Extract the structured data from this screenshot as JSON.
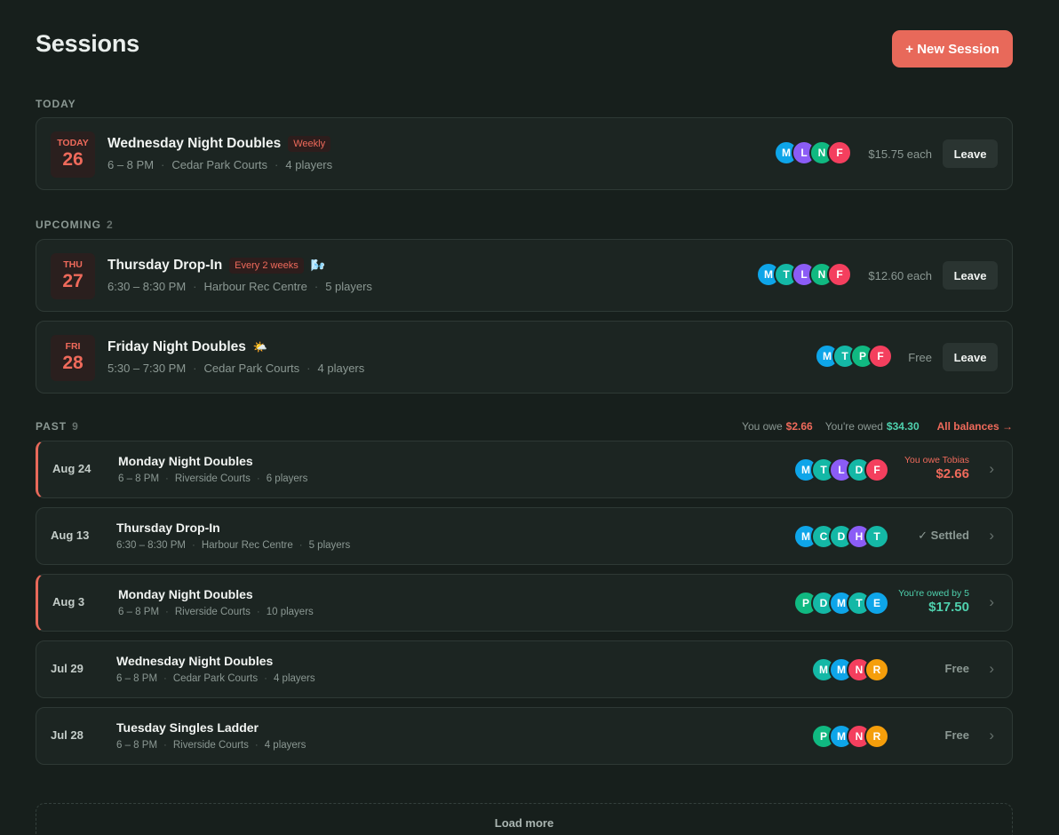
{
  "header": {
    "title": "Sessions",
    "new_button": "+ New Session"
  },
  "colors": {
    "accent": "#e8695a",
    "positive": "#4fd1ae",
    "bg": "#171f1c",
    "card": "#1c2522"
  },
  "today": {
    "label": "TODAY",
    "sessions": [
      {
        "dow": "TODAY",
        "day": "26",
        "name": "Wednesday Night Doubles",
        "tag": "Weekly",
        "weather": "",
        "time": "6 – 8 PM",
        "venue": "Cedar Park Courts",
        "players": "4 players",
        "avatars": [
          {
            "letter": "M",
            "color": "#0ea5e9"
          },
          {
            "letter": "L",
            "color": "#8b5cf6"
          },
          {
            "letter": "N",
            "color": "#10b981"
          },
          {
            "letter": "F",
            "color": "#f43f5e"
          }
        ],
        "price": "$15.75 each",
        "action": "Leave"
      }
    ]
  },
  "upcoming": {
    "label": "UPCOMING",
    "count": "2",
    "sessions": [
      {
        "dow": "THU",
        "day": "27",
        "name": "Thursday Drop-In",
        "tag": "Every 2 weeks",
        "weather": "🌬️",
        "time": "6:30 – 8:30 PM",
        "venue": "Harbour Rec Centre",
        "players": "5 players",
        "avatars": [
          {
            "letter": "M",
            "color": "#0ea5e9"
          },
          {
            "letter": "T",
            "color": "#14b8a6"
          },
          {
            "letter": "L",
            "color": "#8b5cf6"
          },
          {
            "letter": "N",
            "color": "#10b981"
          },
          {
            "letter": "F",
            "color": "#f43f5e"
          }
        ],
        "price": "$12.60 each",
        "action": "Leave"
      },
      {
        "dow": "FRI",
        "day": "28",
        "name": "Friday Night Doubles",
        "tag": "",
        "weather": "🌤️",
        "time": "5:30 – 7:30 PM",
        "venue": "Cedar Park Courts",
        "players": "4 players",
        "avatars": [
          {
            "letter": "M",
            "color": "#0ea5e9"
          },
          {
            "letter": "T",
            "color": "#14b8a6"
          },
          {
            "letter": "P",
            "color": "#10b981"
          },
          {
            "letter": "F",
            "color": "#f43f5e"
          }
        ],
        "price": "Free",
        "action": "Leave"
      }
    ]
  },
  "past": {
    "label": "PAST",
    "count": "9",
    "summary": {
      "owe_label": "You owe",
      "owe_value": "$2.66",
      "owed_label": "You're owed",
      "owed_value": "$34.30",
      "link": "All balances →"
    },
    "sessions": [
      {
        "date": "Aug 24",
        "name": "Monday Night Doubles",
        "time": "6 – 8 PM",
        "venue": "Riverside Courts",
        "players": "6 players",
        "avatars": [
          {
            "letter": "M",
            "color": "#0ea5e9"
          },
          {
            "letter": "T",
            "color": "#14b8a6"
          },
          {
            "letter": "L",
            "color": "#8b5cf6"
          },
          {
            "letter": "D",
            "color": "#14b8a6"
          },
          {
            "letter": "F",
            "color": "#f43f5e"
          }
        ],
        "balance_label": "You owe Tobias",
        "balance_value": "$2.66",
        "balance_kind": "owe",
        "status": ""
      },
      {
        "date": "Aug 13",
        "name": "Thursday Drop-In",
        "time": "6:30 – 8:30 PM",
        "venue": "Harbour Rec Centre",
        "players": "5 players",
        "avatars": [
          {
            "letter": "M",
            "color": "#0ea5e9"
          },
          {
            "letter": "C",
            "color": "#14b8a6"
          },
          {
            "letter": "D",
            "color": "#14b8a6"
          },
          {
            "letter": "H",
            "color": "#8b5cf6"
          },
          {
            "letter": "T",
            "color": "#14b8a6"
          }
        ],
        "balance_label": "",
        "balance_value": "",
        "balance_kind": "",
        "status": "✓ Settled"
      },
      {
        "date": "Aug 3",
        "name": "Monday Night Doubles",
        "time": "6 – 8 PM",
        "venue": "Riverside Courts",
        "players": "10 players",
        "avatars": [
          {
            "letter": "P",
            "color": "#10b981"
          },
          {
            "letter": "D",
            "color": "#14b8a6"
          },
          {
            "letter": "M",
            "color": "#0ea5e9"
          },
          {
            "letter": "T",
            "color": "#14b8a6"
          },
          {
            "letter": "E",
            "color": "#0ea5e9"
          }
        ],
        "balance_label": "You're owed by 5",
        "balance_value": "$17.50",
        "balance_kind": "owed",
        "status": ""
      },
      {
        "date": "Jul 29",
        "name": "Wednesday Night Doubles",
        "time": "6 – 8 PM",
        "venue": "Cedar Park Courts",
        "players": "4 players",
        "avatars": [
          {
            "letter": "M",
            "color": "#14b8a6"
          },
          {
            "letter": "M",
            "color": "#0ea5e9"
          },
          {
            "letter": "N",
            "color": "#f43f5e"
          },
          {
            "letter": "R",
            "color": "#f59e0b"
          }
        ],
        "balance_label": "",
        "balance_value": "",
        "balance_kind": "",
        "status": "Free"
      },
      {
        "date": "Jul 28",
        "name": "Tuesday Singles Ladder",
        "time": "6 – 8 PM",
        "venue": "Riverside Courts",
        "players": "4 players",
        "avatars": [
          {
            "letter": "P",
            "color": "#10b981"
          },
          {
            "letter": "M",
            "color": "#0ea5e9"
          },
          {
            "letter": "N",
            "color": "#f43f5e"
          },
          {
            "letter": "R",
            "color": "#f59e0b"
          }
        ],
        "balance_label": "",
        "balance_value": "",
        "balance_kind": "",
        "status": "Free"
      }
    ],
    "load_more": "Load more"
  }
}
